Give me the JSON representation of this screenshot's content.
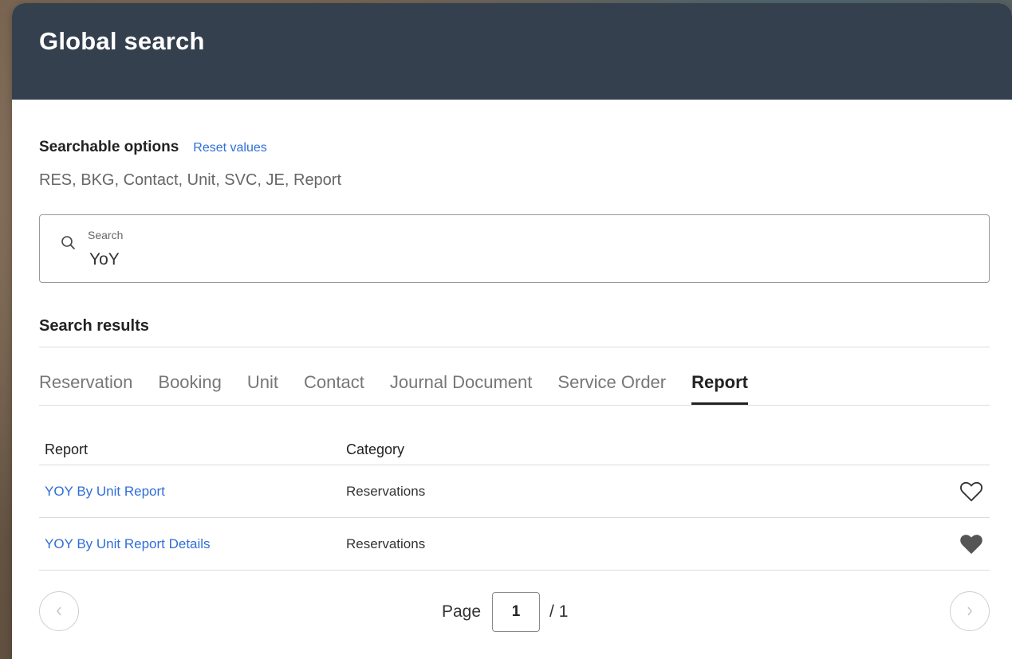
{
  "modal": {
    "title": "Global search"
  },
  "options": {
    "title": "Searchable options",
    "reset_label": "Reset values",
    "list": "RES, BKG, Contact, Unit, SVC, JE, Report"
  },
  "search": {
    "label": "Search",
    "value": "YoY",
    "icon": "search-icon"
  },
  "results": {
    "title": "Search results",
    "tabs": [
      {
        "label": "Reservation",
        "active": false
      },
      {
        "label": "Booking",
        "active": false
      },
      {
        "label": "Unit",
        "active": false
      },
      {
        "label": "Contact",
        "active": false
      },
      {
        "label": "Journal Document",
        "active": false
      },
      {
        "label": "Service Order",
        "active": false
      },
      {
        "label": "Report",
        "active": true
      }
    ],
    "columns": {
      "report": "Report",
      "category": "Category"
    },
    "rows": [
      {
        "report": "YOY By Unit Report",
        "category": "Reservations",
        "favorite": false
      },
      {
        "report": "YOY By Unit Report Details",
        "category": "Reservations",
        "favorite": true
      }
    ]
  },
  "pagination": {
    "page_label": "Page",
    "current_page": "1",
    "total_label": "/ 1",
    "prev_icon": "chevron-left-icon",
    "next_icon": "chevron-right-icon"
  },
  "colors": {
    "header_bg": "#34404e",
    "link": "#2f6fd6",
    "favorite_filled": "#555555"
  }
}
